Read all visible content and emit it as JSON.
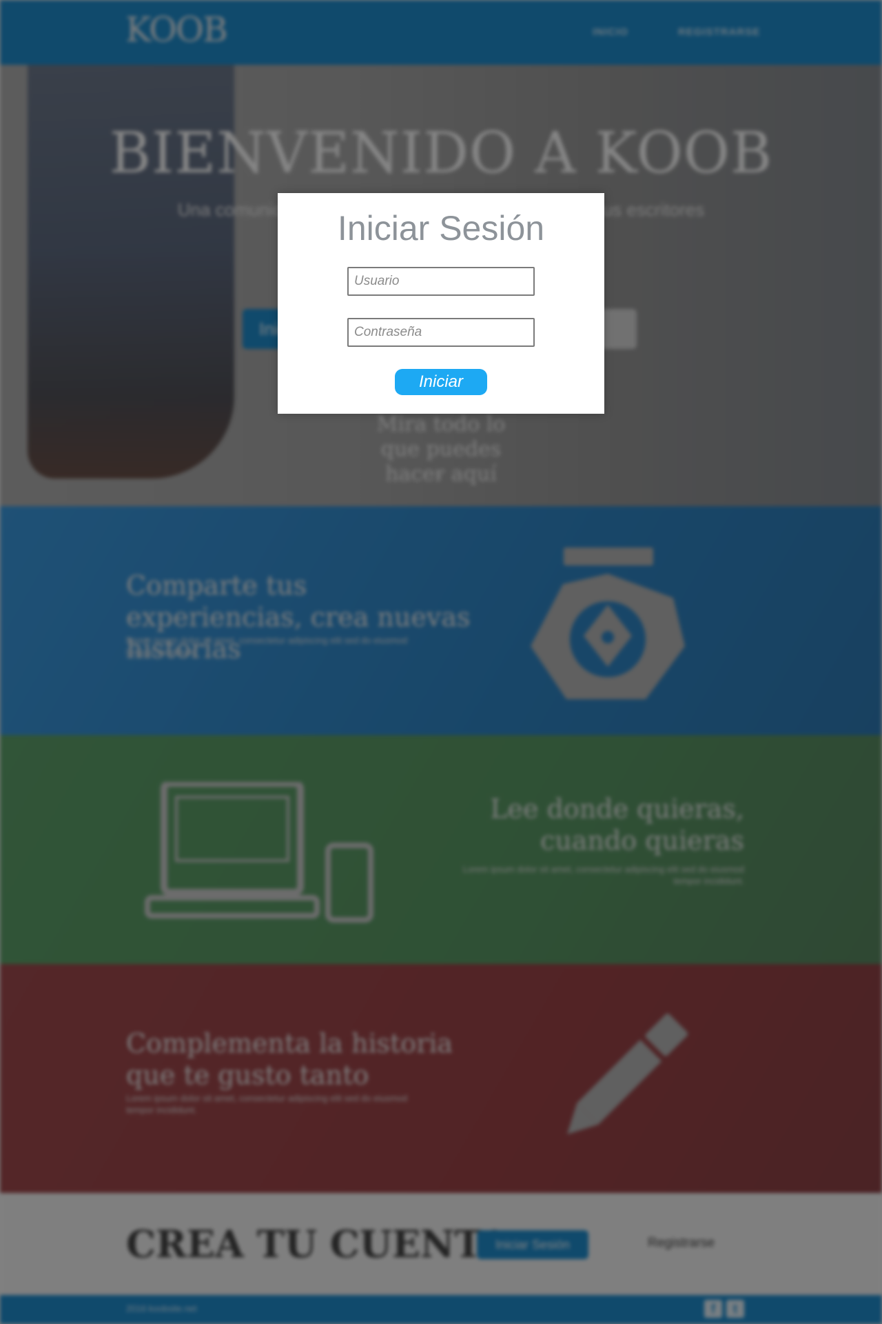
{
  "navbar": {
    "logo": "KOOB",
    "links": [
      "INICIO",
      "REGISTRARSE"
    ]
  },
  "hero": {
    "title": "BIENVENIDO A KOOB",
    "subtitle": "Una comunidad para compartir historias y conocer a tus escritores favoritos",
    "primary_button": "Iniciar Sesión",
    "more_text": "Mira todo lo que puedes hacer aquí",
    "chevron_icon": "chevron-down-icon"
  },
  "features": [
    {
      "title": "Comparte tus experiencias, crea nuevas historias",
      "description": "Lorem ipsum dolor sit amet, consectetur adipiscing elit sed do eiusmod tempor incididunt.",
      "icon": "ink-pen-icon",
      "color": "#2f87c8"
    },
    {
      "title": "Lee donde quieras, cuando quieras",
      "description": "Lorem ipsum dolor sit amet, consectetur adipiscing elit sed do eiusmod tempor incididunt.",
      "icon": "laptop-phone-icon",
      "color": "#5b9a66"
    },
    {
      "title": "Complementa la historia que te gusto tanto",
      "description": "Lorem ipsum dolor sit amet, consectetur adipiscing elit sed do eiusmod tempor incididunt.",
      "icon": "pencil-icon",
      "color": "#9d4448"
    }
  ],
  "cta": {
    "title": "CREA TU CUENTA",
    "button": "Iniciar Sesión",
    "link": "Registrarse"
  },
  "footer": {
    "copyright": "2016 koobsite.net",
    "social": [
      "f",
      "t"
    ]
  },
  "login_modal": {
    "title": "Iniciar Sesión",
    "username_placeholder": "Usuario",
    "password_placeholder": "Contraseña",
    "submit_label": "Iniciar",
    "button_color": "#1da9f3"
  }
}
